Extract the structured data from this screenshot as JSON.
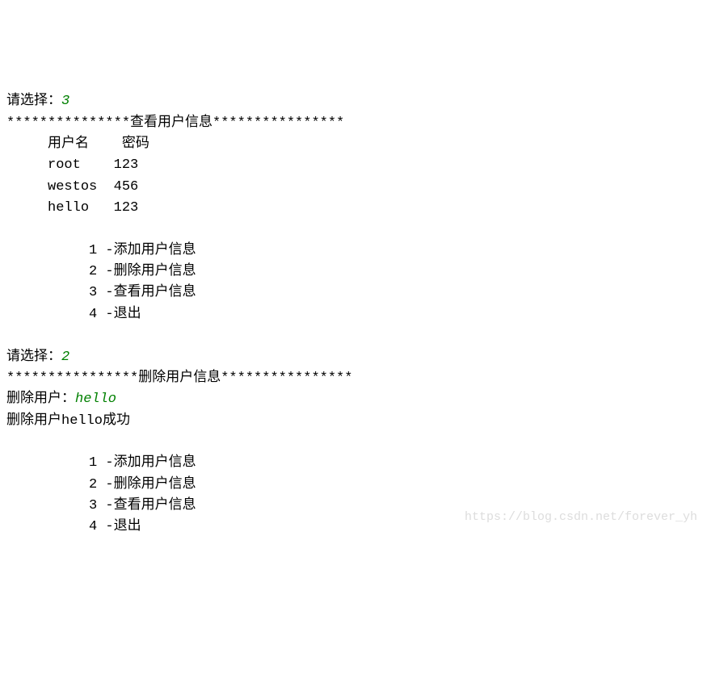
{
  "prompt_label": "请选择：",
  "input1": "3",
  "section_view": {
    "stars_left": "***************",
    "title": "查看用户信息",
    "stars_right": "****************",
    "header_user": "用户名",
    "header_pass": "密码",
    "rows": [
      {
        "user": "root",
        "pass": "123"
      },
      {
        "user": "westos",
        "pass": "456"
      },
      {
        "user": "hello",
        "pass": "123"
      }
    ]
  },
  "menu": {
    "item1": "1 -添加用户信息",
    "item2": "2 -删除用户信息",
    "item3": "3 -查看用户信息",
    "item4": "4 -退出"
  },
  "input2": "2",
  "section_delete": {
    "stars_left": "****************",
    "title": "删除用户信息",
    "stars_right": "****************",
    "delete_prompt": "删除用户：",
    "delete_input": "hello",
    "delete_success_prefix": "删除用户",
    "delete_success_user": "hello",
    "delete_success_suffix": "成功"
  },
  "watermark": "https://blog.csdn.net/forever_yh"
}
